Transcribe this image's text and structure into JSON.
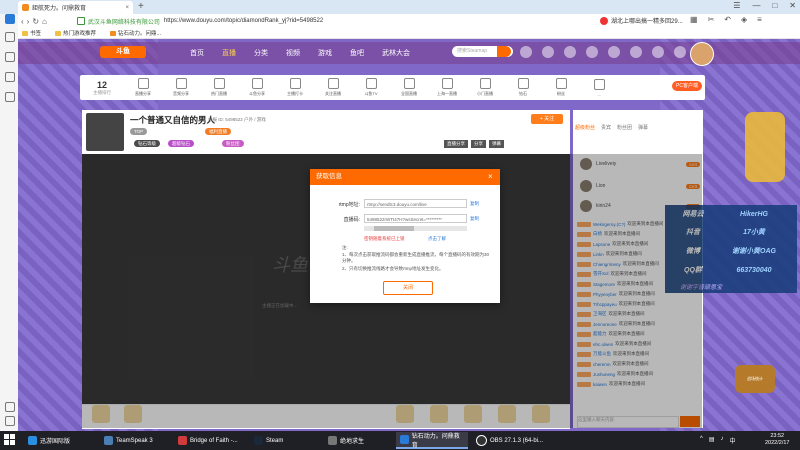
{
  "browser": {
    "tab_title": "鉅航死力。问鼎救育",
    "new_tab": "+",
    "url_site": "武汉斗鱼网络科技有限公司",
    "url": "https://www.douyu.com/topic/diamondRank_yj?rid=5498522",
    "hot_search": "湖北上哪出搞一精多回29...",
    "bookmarks": [
      "书签",
      "热门游戏推荐",
      "钻石动力。问鼎..."
    ]
  },
  "site": {
    "logo": "斗鱼",
    "nav": [
      "首页",
      "直播",
      "分类",
      "视频",
      "游戏",
      "鱼吧",
      "武林大会"
    ],
    "search_placeholder": "搜索Steamap",
    "rank_number": "12",
    "rank_label": "主播排行",
    "categories": [
      "直播分享",
      "音频分享",
      "热门直播",
      "斗鱼分享",
      "主播打卡",
      "关注直播",
      "斗鱼TV",
      "全国直播",
      "上海一直播",
      "小门直播",
      "钻石",
      "粉丝",
      "..."
    ],
    "pc_button": "PC客户端"
  },
  "room": {
    "title": "一个普通又自信的男人",
    "meta": "举报  ID: 5498522  户外 / 游戏",
    "follow": "+ 关注",
    "tags": [
      "直播分享",
      "分享",
      "弹幕"
    ],
    "badges": [
      "TOP",
      "福利直播",
      "钻石等级",
      "超级钻石",
      "粉丝团"
    ],
    "video_status": "主播正在加载中...",
    "video_logo": "斗鱼"
  },
  "modal": {
    "title": "获取信息",
    "close": "×",
    "rtmp_label": "rtmp地址:",
    "rtmp_value": "rtmp://sendtc3.douyu.com/live",
    "key_label": "直播码:",
    "key_value": "5498522rWTt47H?wsSecret=*********",
    "copy": "复制",
    "warn": "密钥随着系统已上锁",
    "learn_more": "点击了解",
    "note_title": "注:",
    "note1": "1、每次点击获取推流码都会重新生成直播推流，每个直播码的有效期为30分钟。",
    "note2": "2、只有切换推流线路才会导致rtmp地址发生变化。",
    "button": "关闭"
  },
  "chat": {
    "tabs": [
      "超级粉丝",
      "贵宾",
      "粉丝团",
      "弹幕"
    ],
    "users": [
      {
        "name": "Liveliveiy",
        "level": "LV4"
      },
      {
        "name": "Lion",
        "level": "LV3"
      },
      {
        "name": "kirin24",
        "level": "LV2"
      }
    ],
    "messages": [
      {
        "name": "Wekirgeroy.(C?)",
        "text": "欢迎来到本直播间"
      },
      {
        "name": "白杨",
        "text": "欢迎来到本直播间"
      },
      {
        "name": "Lapsone",
        "text": "欢迎来到本直播间"
      },
      {
        "name": "Linkn",
        "text": "欢迎来到本直播间"
      },
      {
        "name": "Chiengrimeny",
        "text": "欢迎来到本直播间"
      },
      {
        "name": "雪开Sol",
        "text": "欢迎来到本直播间"
      },
      {
        "name": "Stagemore",
        "text": "欢迎来到本直播间"
      },
      {
        "name": "Phyyeoyber",
        "text": "欢迎来到本直播间"
      },
      {
        "name": "Trhcppayeu",
        "text": "欢迎来到本直播间"
      },
      {
        "name": "卫海区",
        "text": "欢迎来到本直播间"
      },
      {
        "name": "Jennoreone",
        "text": "欢迎来到本直播间"
      },
      {
        "name": "超能力",
        "text": "欢迎来到本直播间"
      },
      {
        "name": "ehc.ulwen",
        "text": "欢迎来到本直播间"
      },
      {
        "name": "万能斗鱼",
        "text": "欢迎来到本直播间"
      },
      {
        "name": "cheremn",
        "text": "欢迎来到本直播间"
      },
      {
        "name": "Jushuneng",
        "text": "欢迎来到本直播间"
      },
      {
        "name": "kaiwen",
        "text": "欢迎来到本直播间"
      }
    ],
    "input_placeholder": "这里输入聊天内容"
  },
  "overlay": {
    "rows": [
      {
        "k": "网易云",
        "v": "HikerHG"
      },
      {
        "k": "抖音",
        "v": "17小黄"
      },
      {
        "k": "微博",
        "v": "谢谢小黄OAG"
      },
      {
        "k": "QQ群",
        "v": "663730040"
      }
    ],
    "sub": "谢谢字音顽恩宝",
    "corner_text": "战场统计"
  },
  "taskbar": {
    "items": [
      "迅游国际版",
      "TeamSpeak 3",
      "Bridge of Faith -...",
      "Steam",
      "绝地求生",
      "钻石动力。问鼎救育",
      "OBS 27.1.3 (64-bi..."
    ],
    "time": "23:52",
    "date": "2022/2/17"
  }
}
